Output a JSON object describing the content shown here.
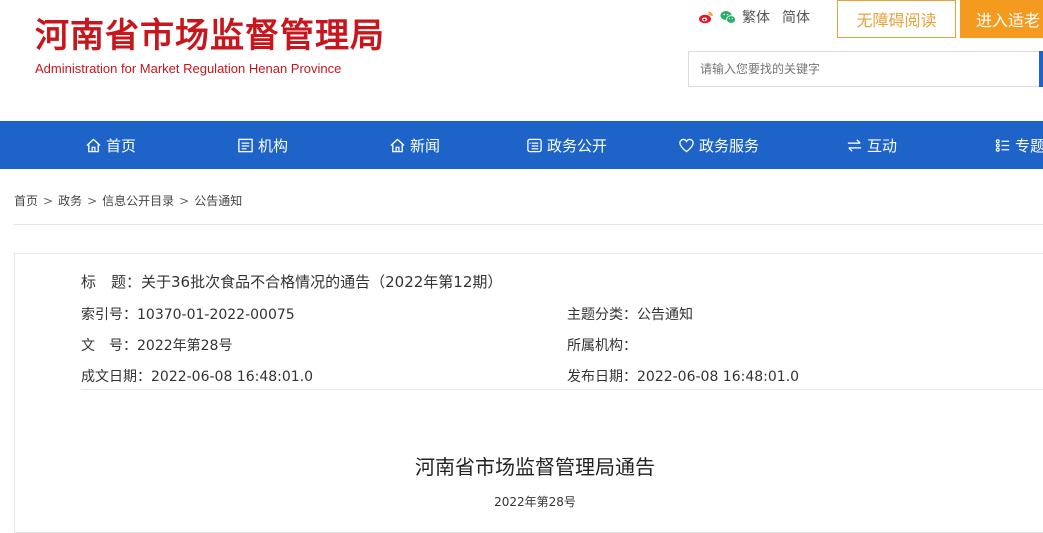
{
  "header": {
    "title_cn": "河南省市场监督管理局",
    "title_en": "Administration for Market Regulation Henan Province",
    "top_links": {
      "traditional": "繁体",
      "simplified": "简体"
    },
    "accessibility_label": "无障碍阅读",
    "elder_label": "进入适老",
    "search_placeholder": "请输入您要找的关键字",
    "icons": [
      "weibo-icon",
      "wechat-icon"
    ],
    "brand_color": "#c8161d",
    "accent_color": "#f39a1f"
  },
  "nav": {
    "background": "#1e64c8",
    "items": [
      {
        "label": "首页",
        "icon": "home-icon"
      },
      {
        "label": "机构",
        "icon": "institution-icon"
      },
      {
        "label": "新闻",
        "icon": "news-icon"
      },
      {
        "label": "政务公开",
        "icon": "open-affairs-icon"
      },
      {
        "label": "政务服务",
        "icon": "heart-icon"
      },
      {
        "label": "互动",
        "icon": "exchange-icon"
      },
      {
        "label": "专题",
        "icon": "topics-icon"
      }
    ]
  },
  "breadcrumb": [
    "首页",
    "政务",
    "信息公开目录",
    "公告通知"
  ],
  "breadcrumb_separator": ">",
  "meta": {
    "title_label": "标　题：",
    "title_value": "关于36批次食品不合格情况的通告（2022年第12期）",
    "index_label": "索引号：",
    "index_value": "10370-01-2022-00075",
    "topic_label": "主题分类：",
    "topic_value": "公告通知",
    "docno_label": "文　号：",
    "docno_value": "2022年第28号",
    "org_label": "所属机构：",
    "org_value": "",
    "created_label": "成文日期：",
    "created_value": "2022-06-08 16:48:01.0",
    "published_label": "发布日期：",
    "published_value": "2022-06-08 16:48:01.0"
  },
  "document": {
    "heading": "河南省市场监督管理局通告",
    "number": "2022年第28号"
  }
}
